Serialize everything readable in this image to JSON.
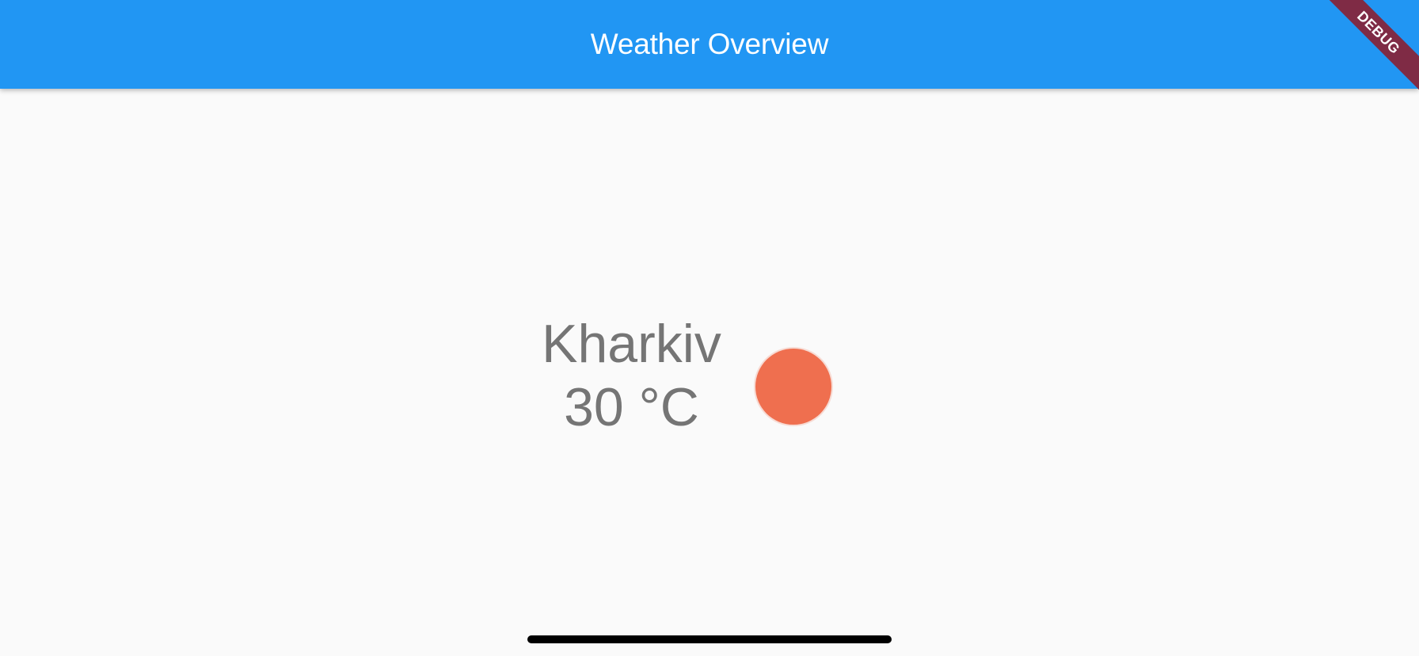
{
  "app_bar": {
    "title": "Weather Overview"
  },
  "debug_banner": {
    "label": "DEBUG"
  },
  "weather": {
    "city": "Kharkiv",
    "temperature": "30 °C",
    "icon": "sun-icon",
    "icon_color": "#ef6f4f"
  },
  "colors": {
    "app_bar": "#2196f3",
    "background": "#fafafa",
    "text": "#757575",
    "debug_banner": "#7f2b45"
  }
}
